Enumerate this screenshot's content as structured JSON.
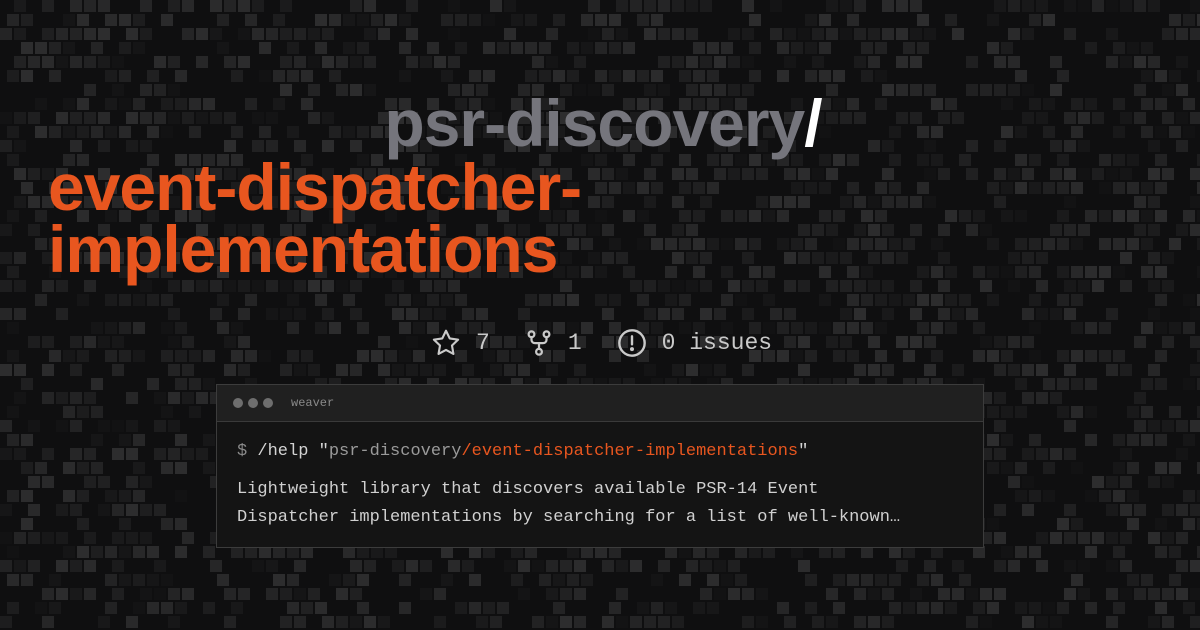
{
  "title": {
    "owner": "psr-discovery",
    "separator": "/",
    "repo": "event-dispatcher-implementations"
  },
  "stats": {
    "stars": "7",
    "forks": "1",
    "issues": "0 issues"
  },
  "terminal": {
    "window_title": "weaver",
    "prompt": "$",
    "command": "/help",
    "quote_open": "\"",
    "arg_owner": "psr-discovery",
    "arg_separator": "/",
    "arg_repo": "event-dispatcher-implementations",
    "quote_close": "\"",
    "description_line1": "Lightweight library that discovers available PSR-14 Event",
    "description_line2": "Dispatcher implementations by searching for a list of well-known…"
  },
  "icons": {
    "star": "star-icon",
    "fork": "fork-icon",
    "issue": "issue-icon"
  },
  "colors": {
    "accent": "#e8561f",
    "owner": "#75757c",
    "background": "#0f0f10"
  }
}
